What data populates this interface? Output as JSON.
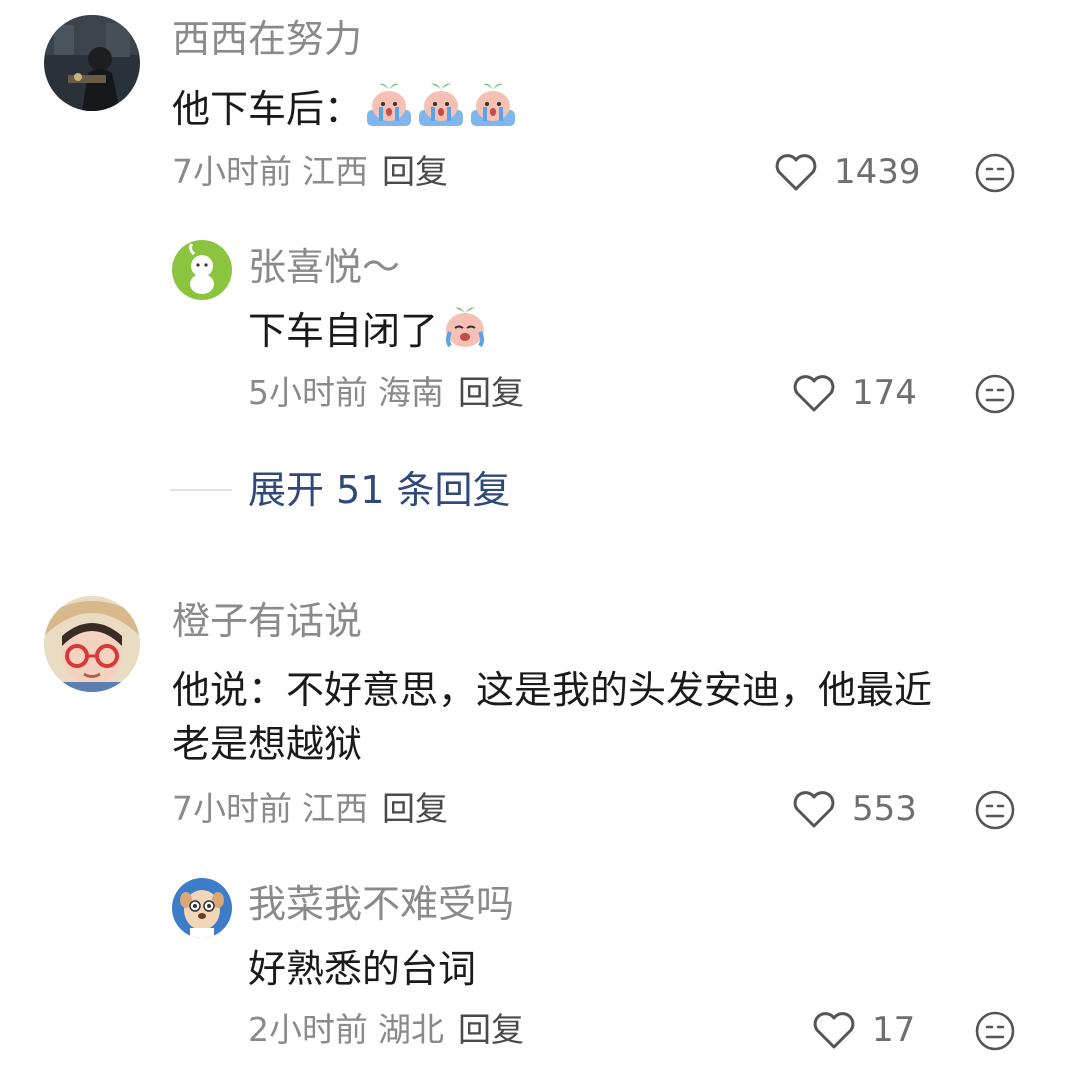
{
  "comments": [
    {
      "username": "西西在努力",
      "content": "他下车后：",
      "emoji_count": 3,
      "time": "7小时前",
      "location": "江西",
      "reply_label": "回复",
      "likes": "1439",
      "replies": [
        {
          "username": "张喜悦～",
          "content": "下车自闭了",
          "emoji_count": 1,
          "time": "5小时前",
          "location": "海南",
          "reply_label": "回复",
          "likes": "174"
        }
      ],
      "expand_label": "展开 51 条回复"
    },
    {
      "username": "橙子有话说",
      "content_line1": "他说：不好意思，这是我的头发安迪，他最近",
      "content_line2": "老是想越狱",
      "time": "7小时前",
      "location": "江西",
      "reply_label": "回复",
      "likes": "553",
      "replies": [
        {
          "username": "我菜我不难受吗",
          "content": "好熟悉的台词",
          "time": "2小时前",
          "location": "湖北",
          "reply_label": "回复",
          "likes": "17"
        }
      ]
    }
  ],
  "icons": {
    "like": "heart-outline-icon",
    "dislike": "neutral-face-icon",
    "emoji": "crying-peach-emoji"
  },
  "colors": {
    "username": "#8a8a8a",
    "text": "#1a1a1a",
    "meta": "#8a8a8a",
    "expand_link": "#2f4a78"
  }
}
